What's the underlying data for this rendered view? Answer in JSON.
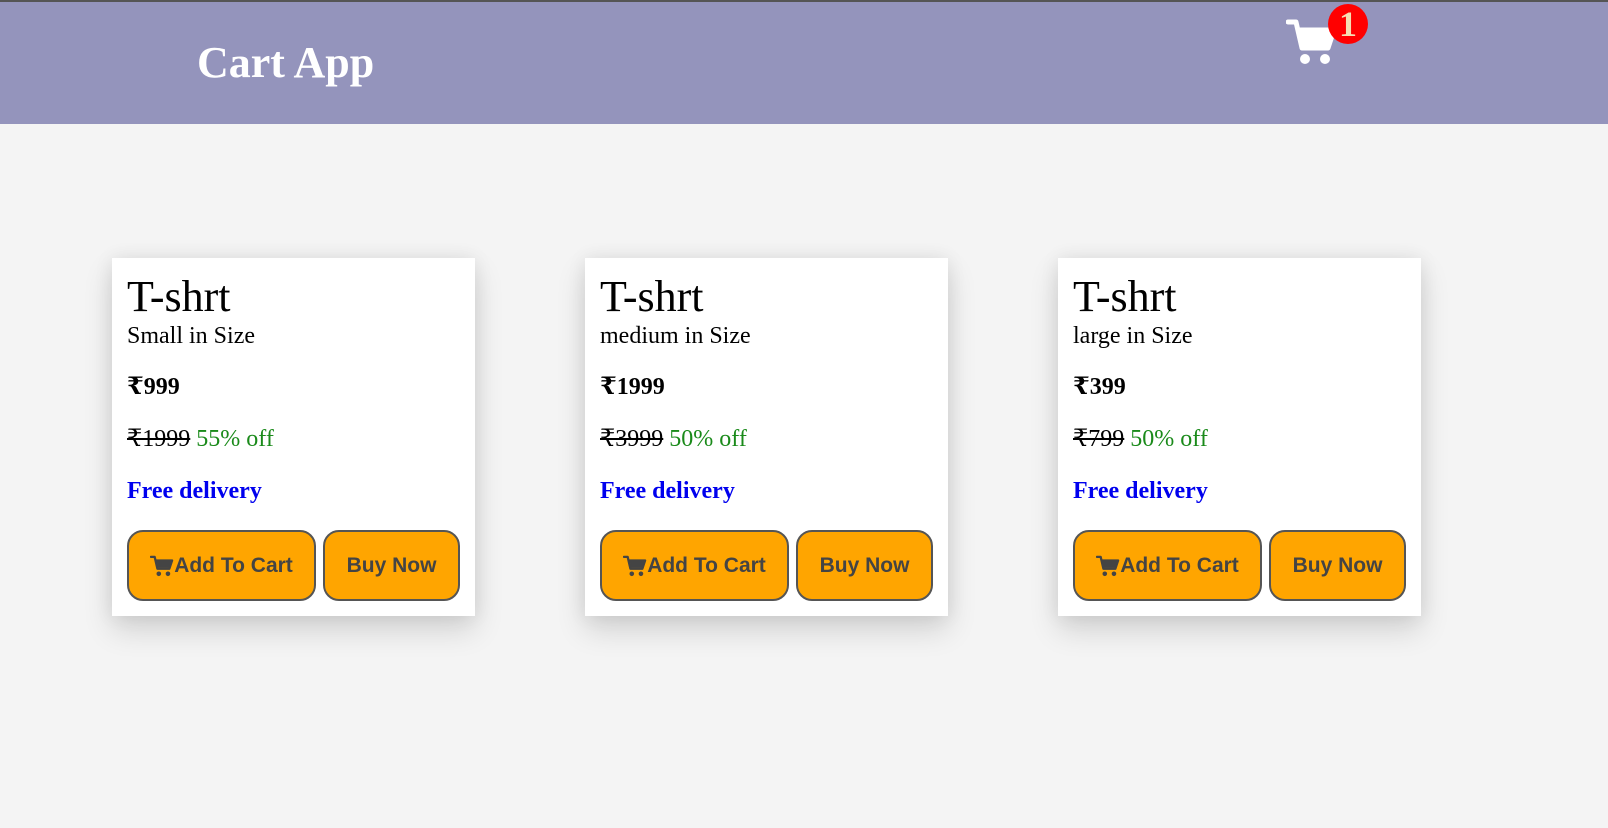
{
  "header": {
    "title": "Cart App",
    "cart_count": "1"
  },
  "products": [
    {
      "name": "T-shrt",
      "size": "Small in Size",
      "price": "₹999",
      "original_price": "₹1999",
      "discount": "55% off",
      "delivery": "Free delivery",
      "add_label": "Add To Cart",
      "buy_label": "Buy Now"
    },
    {
      "name": "T-shrt",
      "size": "medium in Size",
      "price": "₹1999",
      "original_price": "₹3999",
      "discount": "50% off",
      "delivery": "Free delivery",
      "add_label": "Add To Cart",
      "buy_label": "Buy Now"
    },
    {
      "name": "T-shrt",
      "size": "large in Size",
      "price": "₹399",
      "original_price": "₹799",
      "discount": "50% off",
      "delivery": "Free delivery",
      "add_label": "Add To Cart",
      "buy_label": "Buy Now"
    }
  ],
  "icons": {
    "header_cart": "shopping-cart-icon",
    "button_cart": "shopping-cart-icon"
  },
  "colors": {
    "header_bg": "#9494bc",
    "button_bg": "#ffa500",
    "badge_bg": "#ff0000",
    "discount": "#1a8a1a",
    "delivery": "#0000ee"
  }
}
